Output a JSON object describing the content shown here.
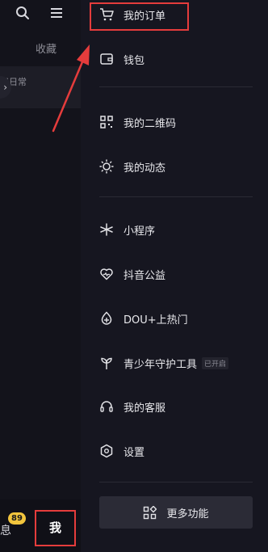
{
  "background_page": {
    "tab_label": "收藏",
    "tag_text": "和日常",
    "bottom_nav": {
      "messages_label": "息",
      "messages_badge": "89",
      "me_label": "我"
    }
  },
  "drawer": {
    "menu_items": [
      {
        "label": "我的订单",
        "icon": "cart-icon"
      },
      {
        "label": "钱包",
        "icon": "wallet-icon"
      },
      {
        "label": "我的二维码",
        "icon": "qrcode-icon"
      },
      {
        "label": "我的动态",
        "icon": "activity-icon"
      },
      {
        "label": "小程序",
        "icon": "mini-program-icon"
      },
      {
        "label": "抖音公益",
        "icon": "charity-heart-icon"
      },
      {
        "label": "DOU+上热门",
        "icon": "dou-plus-icon"
      },
      {
        "label": "青少年守护工具",
        "icon": "sprout-icon",
        "tag": "已开启"
      },
      {
        "label": "我的客服",
        "icon": "headset-icon"
      },
      {
        "label": "设置",
        "icon": "settings-icon"
      }
    ],
    "more_button": {
      "label": "更多功能",
      "icon": "grid-icon"
    }
  },
  "annotation": {
    "highlight_color": "#e53c3c"
  }
}
